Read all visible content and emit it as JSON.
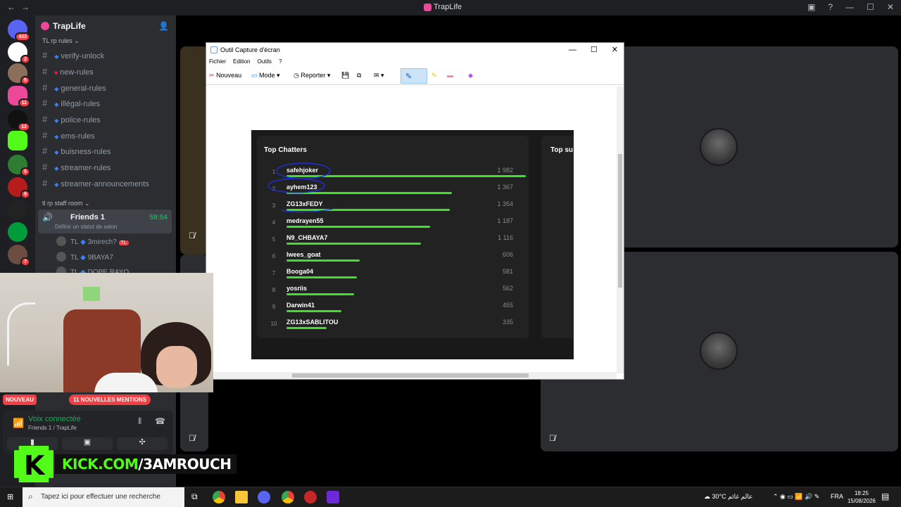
{
  "window": {
    "title": "TrapLife"
  },
  "server": {
    "name": "TrapLife",
    "categories": {
      "rules": "TL rp rules",
      "staff": "tl rp staff room"
    },
    "channels": [
      {
        "label": "verify-unlock"
      },
      {
        "label": "new-rules"
      },
      {
        "label": "general-rules"
      },
      {
        "label": "illégal-rules"
      },
      {
        "label": "police-rules"
      },
      {
        "label": "ems-rules"
      },
      {
        "label": "buisness-rules"
      },
      {
        "label": "streamer-rules"
      },
      {
        "label": "streamer-announcements"
      }
    ],
    "voice_channel": {
      "name": "Friends 1",
      "status": "Définir un statut de salon",
      "timer": "59:54"
    },
    "members": [
      {
        "tag": "TL",
        "name": "3mirech?",
        "badge": "TL"
      },
      {
        "tag": "TL",
        "name": "9BAYA7"
      },
      {
        "tag": "TL",
        "name": "DOPE RAYO"
      }
    ],
    "rail_badges": [
      "433",
      "2",
      "5",
      "11",
      "12",
      "5",
      "9",
      "7"
    ]
  },
  "notifications": {
    "new": "NOUVEAU",
    "mentions": "11 NOUVELLES MENTIONS"
  },
  "voice_panel": {
    "status": "Voix connectée",
    "location": "Friends 1 / TrapLife"
  },
  "kick": {
    "prefix": "KICK.COM",
    "handle": "/3AMROUCH"
  },
  "snip": {
    "title": "Outil Capture d'écran",
    "menu": [
      "Fichier",
      "Edition",
      "Outils",
      "?"
    ],
    "toolbar": {
      "new": "Nouveau",
      "mode": "Mode",
      "delay": "Reporter"
    }
  },
  "capture": {
    "title": "Top Chatters",
    "title2": "Top su",
    "entries": [
      {
        "rank": "1",
        "name": "safehjoker",
        "count": "1 982",
        "value": 1982
      },
      {
        "rank": "2",
        "name": "ayhem123",
        "count": "1 367",
        "value": 1367
      },
      {
        "rank": "3",
        "name": "ZG13xFEDY",
        "count": "1 354",
        "value": 1354
      },
      {
        "rank": "4",
        "name": "medrayen55",
        "count": "1 187",
        "value": 1187
      },
      {
        "rank": "5",
        "name": "N9_CHBAYA7",
        "count": "1 116",
        "value": 1116
      },
      {
        "rank": "6",
        "name": "lwees_goat",
        "count": "606",
        "value": 606
      },
      {
        "rank": "7",
        "name": "Booga04",
        "count": "581",
        "value": 581
      },
      {
        "rank": "8",
        "name": "yosriis",
        "count": "562",
        "value": 562
      },
      {
        "rank": "9",
        "name": "Darwin41",
        "count": "455",
        "value": 455
      },
      {
        "rank": "10",
        "name": "ZG13xSABLITOU",
        "count": "335",
        "value": 335
      }
    ]
  },
  "taskbar": {
    "search_placeholder": "Tapez ici pour effectuer une recherche",
    "weather": "30°C",
    "weather_text": "عالم غائم",
    "lang": "FRA",
    "time": "18:25",
    "date": "15/08/2026"
  },
  "colors": {
    "bar": "#3ee02b",
    "kick_green": "#53fc18",
    "discord_green": "#23a55a",
    "badge_red": "#f23f43"
  }
}
